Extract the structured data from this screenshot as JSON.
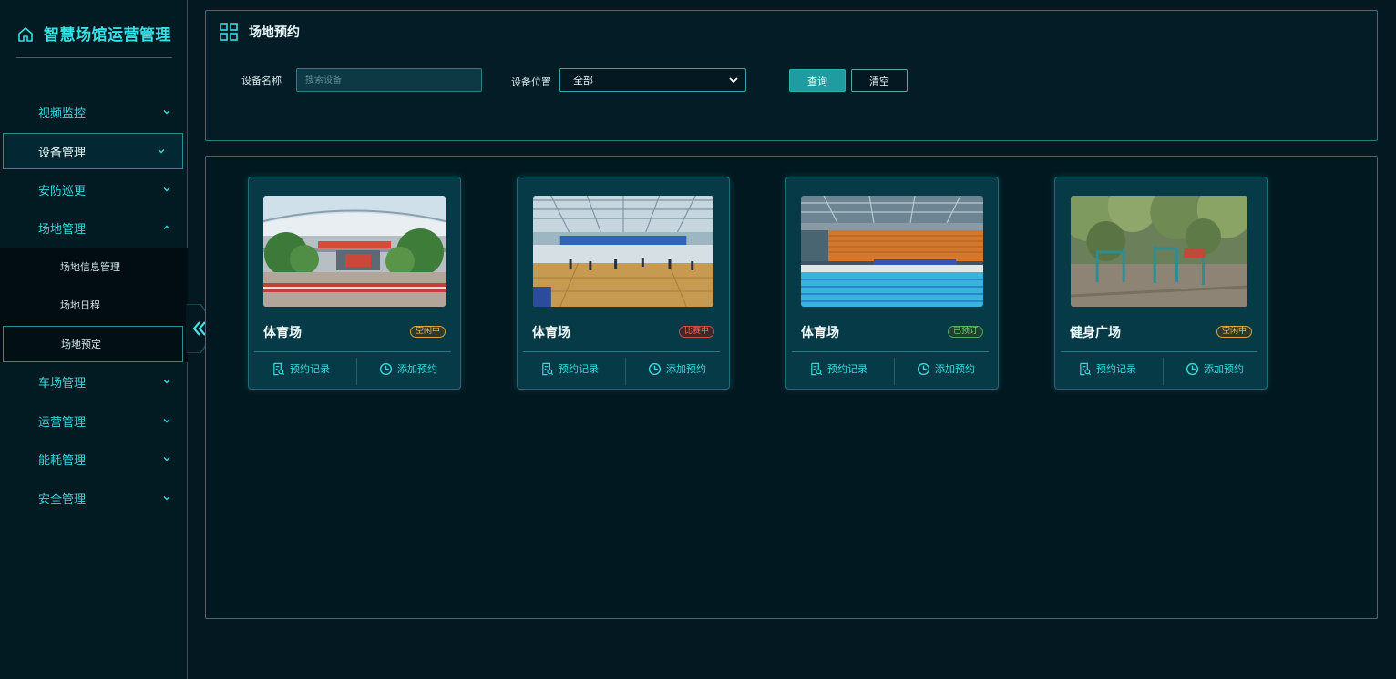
{
  "app": {
    "title": "智慧场馆运营管理"
  },
  "sidebar": {
    "items": [
      {
        "label": "视频监控",
        "expanded": false
      },
      {
        "label": "设备管理",
        "expanded": false
      },
      {
        "label": "安防巡更",
        "expanded": false
      },
      {
        "label": "场地管理",
        "expanded": true
      },
      {
        "label": "车场管理",
        "expanded": false
      },
      {
        "label": "运营管理",
        "expanded": false
      },
      {
        "label": "能耗管理",
        "expanded": false
      },
      {
        "label": "安全管理",
        "expanded": false
      }
    ],
    "subitems": [
      {
        "label": "场地信息管理"
      },
      {
        "label": "场地日程"
      },
      {
        "label": "场地预定",
        "active": true
      }
    ]
  },
  "search": {
    "title": "场地预约",
    "name_label": "设备名称",
    "name_placeholder": "搜索设备",
    "name_value": "",
    "location_label": "设备位置",
    "location_value": "全部",
    "query_label": "查询",
    "clear_label": "清空"
  },
  "cards": [
    {
      "name": "体育场",
      "status": "空闲中",
      "status_type": "idle",
      "image": "stadium-exterior",
      "record_label": "预约记录",
      "add_label": "添加预约"
    },
    {
      "name": "体育场",
      "status": "比赛中",
      "status_type": "match",
      "image": "indoor-gym",
      "record_label": "预约记录",
      "add_label": "添加预约"
    },
    {
      "name": "体育场",
      "status": "已预订",
      "status_type": "booked",
      "image": "swimming-pool",
      "record_label": "预约记录",
      "add_label": "添加预约"
    },
    {
      "name": "健身广场",
      "status": "空闲中",
      "status_type": "idle",
      "image": "fitness-plaza",
      "record_label": "预约记录",
      "add_label": "添加预约"
    }
  ],
  "colors": {
    "accent": "#36e0e4",
    "background": "#031820",
    "card": "#063a47",
    "status_idle": "#f2c25a",
    "status_match": "#f26a5a",
    "status_booked": "#7ed37a"
  }
}
